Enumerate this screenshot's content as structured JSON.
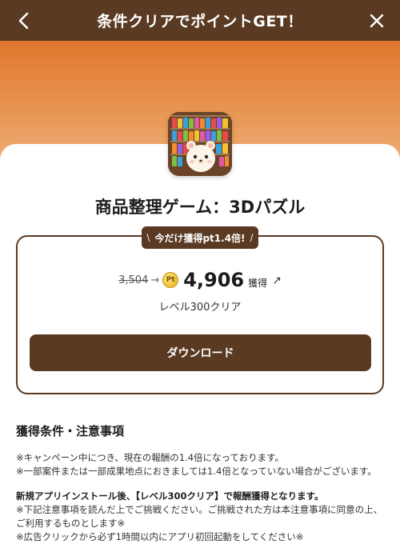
{
  "header": {
    "title": "条件クリアでポイントGET！",
    "back_icon": "chevron-left-icon",
    "close_icon": "close-icon"
  },
  "colors": {
    "brand": "#5a3a22",
    "hero_top": "#e0762e",
    "hero_bottom": "#eeb07c",
    "coin": "#e8b21c"
  },
  "app": {
    "title": "商品整理ゲーム：3Dパズル",
    "icon": "app-icon-shelf-bear"
  },
  "reward": {
    "badge": "今だけ獲得pt1.4倍!",
    "old_points": "3,504",
    "coin_label": "Pt",
    "new_points": "4,906",
    "points_unit": "獲得",
    "condition": "レベル300クリア",
    "download_label": "ダウンロード"
  },
  "notes": {
    "heading": "獲得条件・注意事項",
    "lines": [
      "※キャンペーン中につき、現在の報酬の1.4倍になっております。",
      "※一部案件または一部成果地点におきましては1.4倍となっていない場合がございます。"
    ],
    "strong_line": "新規アプリインストール後、【レベル300クリア】で報酬獲得となります。",
    "lines2": [
      "※下記注意事項を読んだ上でご挑戦ください。ご挑戦された方は本注意事項に同意の上、ご利用するものとします※",
      "※広告クリックから必ず1時間以内にアプリ初回起動をしてください※"
    ]
  }
}
